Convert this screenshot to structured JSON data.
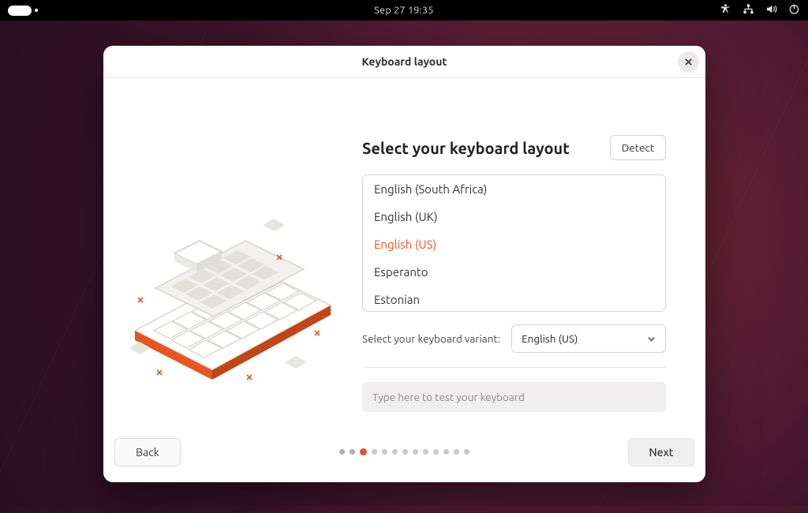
{
  "topbar": {
    "clock": "Sep 27  19:35"
  },
  "window": {
    "title": "Keyboard layout"
  },
  "main": {
    "heading": "Select your keyboard layout",
    "detect_label": "Detect",
    "layouts": [
      "English (South Africa)",
      "English (UK)",
      "English (US)",
      "Esperanto",
      "Estonian"
    ],
    "selected_index": 2,
    "variant_label": "Select your keyboard variant:",
    "variant_value": "English (US)",
    "test_placeholder": "Type here to test your keyboard"
  },
  "footer": {
    "back_label": "Back",
    "next_label": "Next",
    "total_steps": 13,
    "current_step": 3
  }
}
